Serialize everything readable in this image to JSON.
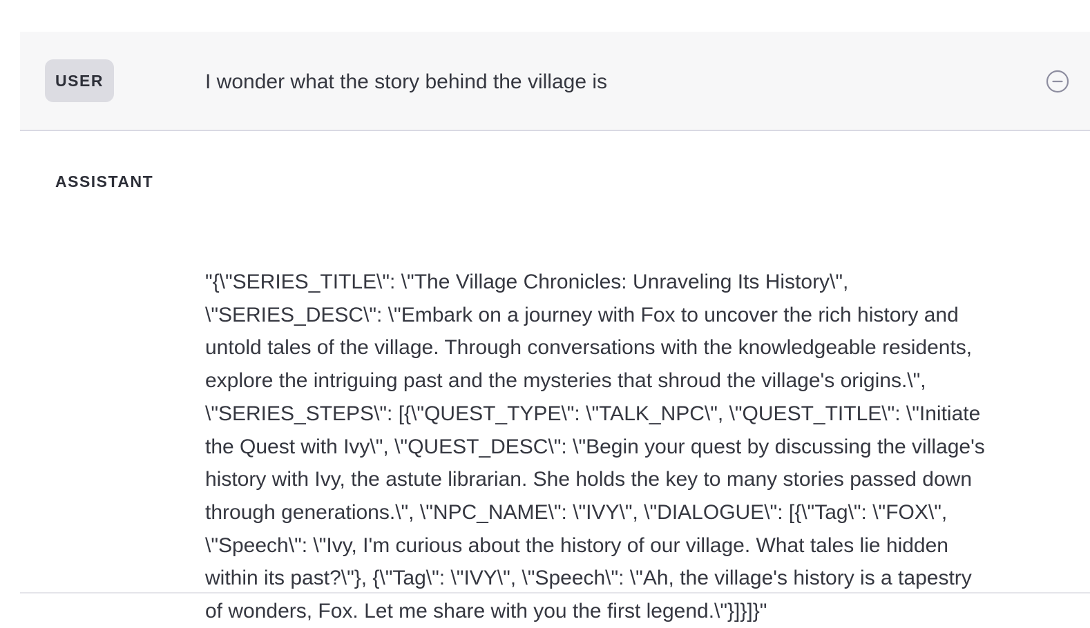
{
  "messages": [
    {
      "role": "USER",
      "content": "I wonder what the story behind the village is"
    },
    {
      "role": "ASSISTANT",
      "content": "\"{\\\"SERIES_TITLE\\\": \\\"The Village Chronicles: Unraveling Its History\\\", \\\"SERIES_DESC\\\": \\\"Embark on a journey with Fox to uncover the rich history and untold tales of the village. Through conversations with the knowledgeable residents, explore the intriguing past and the mysteries that shroud the village's origins.\\\", \\\"SERIES_STEPS\\\": [{\\\"QUEST_TYPE\\\": \\\"TALK_NPC\\\", \\\"QUEST_TITLE\\\": \\\"Initiate the Quest with Ivy\\\", \\\"QUEST_DESC\\\": \\\"Begin your quest by discussing the village's history with Ivy, the astute librarian. She holds the key to many stories passed down through generations.\\\", \\\"NPC_NAME\\\": \\\"IVY\\\", \\\"DIALOGUE\\\": [{\\\"Tag\\\": \\\"FOX\\\", \\\"Speech\\\": \\\"Ivy, I'm curious about the history of our village. What tales lie hidden within its past?\\\"}, {\\\"Tag\\\": \\\"IVY\\\", \\\"Speech\\\": \\\"Ah, the village's history is a tapestry of wonders, Fox. Let me share with you the first legend.\\\"}]}]}\""
    }
  ],
  "icons": {
    "remove": "minus-circle-icon"
  },
  "colors": {
    "user_bg": "#f7f7f8",
    "pill_bg": "#dcdce2",
    "text": "#353740",
    "icon": "#8e8ea0"
  }
}
